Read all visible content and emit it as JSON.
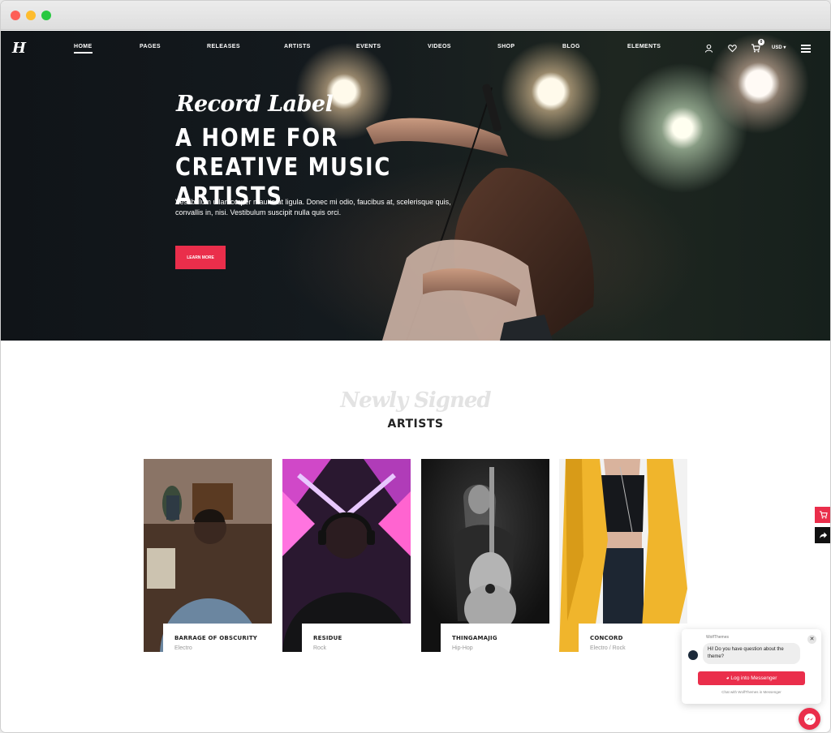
{
  "nav": {
    "logo": "H",
    "items": [
      {
        "label": "Home",
        "active": true
      },
      {
        "label": "Pages"
      },
      {
        "label": "Releases"
      },
      {
        "label": "Artists"
      },
      {
        "label": "Events"
      },
      {
        "label": "Videos"
      },
      {
        "label": "Shop"
      },
      {
        "label": "Blog"
      },
      {
        "label": "Elements"
      }
    ],
    "cart_count": "0",
    "currency": "USD"
  },
  "hero": {
    "script_title": "Record Label",
    "title": "A HOME FOR CREATIVE MUSIC ARTISTS",
    "text": "Vestibulum ullamcorper mauris at ligula. Donec mi odio, faucibus at, scelerisque quis, convallis in, nisi. Vestibulum suscipit nulla quis orci.",
    "button": "Learn more"
  },
  "section": {
    "script_title": "Newly Signed",
    "title": "ARTISTS"
  },
  "artists": [
    {
      "name": "Barrage of Obscurity",
      "genre": "Electro"
    },
    {
      "name": "Residue",
      "genre": "Rock"
    },
    {
      "name": "Thingamajig",
      "genre": "Hip-Hop"
    },
    {
      "name": "Concord",
      "genre": "Electro / Rock"
    }
  ],
  "messenger": {
    "from": "WolfThemes",
    "message": "Hi! Do you have question about the theme?",
    "login_button": "Log into Messenger",
    "footer": "Chat with WolfThemes in Messenger"
  },
  "colors": {
    "accent": "#ea2e4b",
    "hero_bg": "#101418"
  }
}
